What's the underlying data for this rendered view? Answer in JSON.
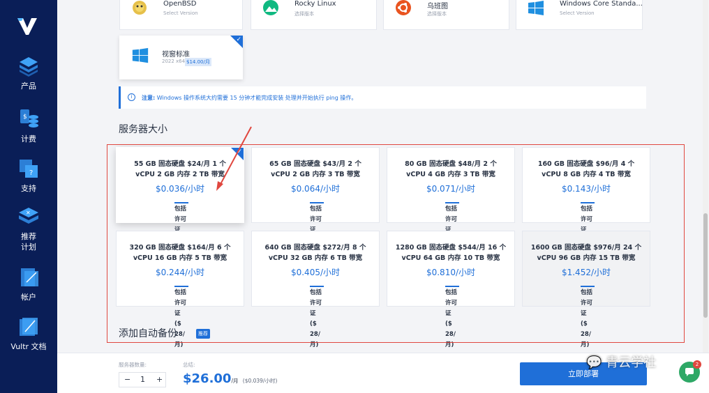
{
  "sidebar": {
    "items": [
      {
        "label": "产品",
        "icon": "stack-icon"
      },
      {
        "label": "计费",
        "icon": "coins-icon"
      },
      {
        "label": "支持",
        "icon": "support-icon"
      },
      {
        "label": "推荐\n计划",
        "icon": "referral-icon"
      },
      {
        "label": "帐户",
        "icon": "account-icon"
      },
      {
        "label": "Vultr 文档",
        "icon": "docs-icon"
      }
    ]
  },
  "os": {
    "cards": [
      {
        "name": "OpenBSD",
        "sub": "Select Version",
        "icon": "openbsd-icon"
      },
      {
        "name": "Rocky Linux",
        "sub": "选择版本",
        "icon": "rocky-linux-icon"
      },
      {
        "name": "乌班图",
        "sub": "选择版本",
        "icon": "ubuntu-icon"
      },
      {
        "name": "Windows Core Standa...",
        "sub": "Select Version",
        "icon": "windows-icon"
      }
    ],
    "windows_card": {
      "name": "视窗标准",
      "sub": "2022 x64",
      "price_tag": "$14.00/月"
    }
  },
  "notice": {
    "label": "注意:",
    "text": "Windows 操作系统大约需要 15 分钟才能完成安装 处理并开始执行 ping 操作。",
    "icon": "i"
  },
  "server_size": {
    "title": "服务器大小",
    "license_line1": "包括",
    "license_line2": "许可",
    "license_line3": "证",
    "license_line4": "($",
    "license_line5": "28/",
    "license_line6": "月)",
    "plans": [
      {
        "line1": "55 GB 固态硬盘 $24/月 1 个",
        "line2": "vCPU 2 GB 内存 2 TB 带宽",
        "price": "$0.036/小时"
      },
      {
        "line1": "65 GB 固态硬盘 $43/月 2 个",
        "line2": "vCPU 2 GB 内存 3 TB 带宽",
        "price": "$0.064/小时"
      },
      {
        "line1": "80 GB 固态硬盘 $48/月 2 个",
        "line2": "vCPU 4 GB 内存 3 TB 带宽",
        "price": "$0.071/小时"
      },
      {
        "line1": "160 GB 固态硬盘 $96/月 4 个",
        "line2": "vCPU 8 GB 内存 4 TB 带宽",
        "price": "$0.143/小时"
      },
      {
        "line1": "320 GB 固态硬盘 $164/月 6 个",
        "line2": "vCPU 16 GB 内存 5 TB 带宽",
        "price": "$0.244/小时"
      },
      {
        "line1": "640 GB 固态硬盘 $272/月 8 个",
        "line2": "vCPU 32 GB 内存 6 TB 带宽",
        "price": "$0.405/小时"
      },
      {
        "line1": "1280 GB 固态硬盘 $544/月 16 个",
        "line2": "vCPU 64 GB 内存 10 TB 带宽",
        "price": "$0.810/小时"
      },
      {
        "line1": "1600 GB 固态硬盘 $976/月 24 个",
        "line2": "vCPU 96 GB 内存 15 TB 带宽",
        "price": "$1.452/小时"
      }
    ]
  },
  "backup": {
    "title": "添加自动备份",
    "badge": "推荐"
  },
  "bottom": {
    "qty_label": "服务器数量:",
    "qty_value": "1",
    "minus": "−",
    "plus": "+",
    "total_label": "总结:",
    "total_price": "$26.00",
    "total_unit": "/月",
    "total_hourly": "($0.039/小时)",
    "deploy_label": "立即部署"
  },
  "watermark": "青云学社",
  "chat_badge": "2",
  "colors": {
    "sidebar": "#0a1e57",
    "accent": "#1f6fd8",
    "highlight": "#e0473f"
  }
}
